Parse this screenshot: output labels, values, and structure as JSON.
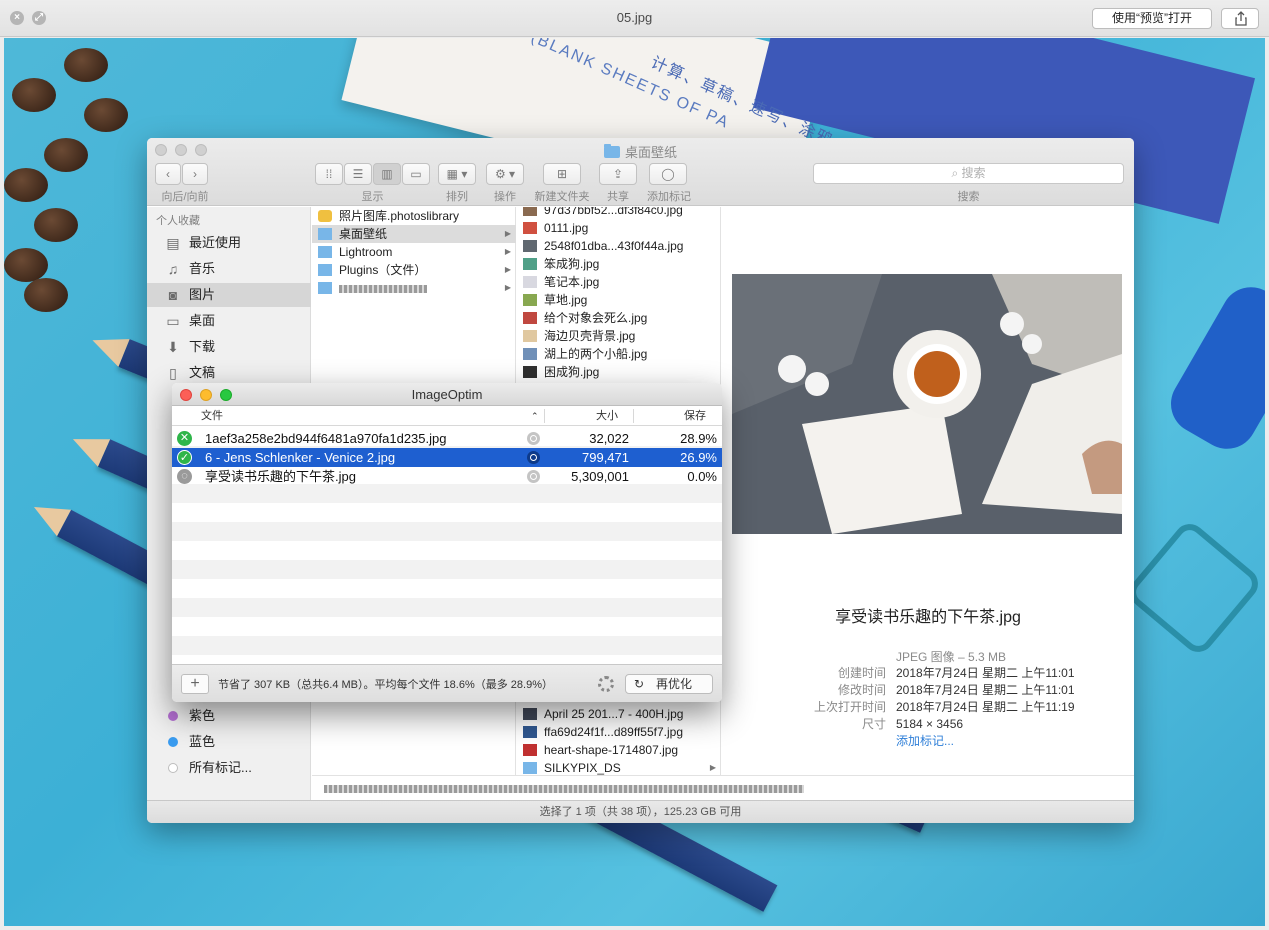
{
  "quicklook": {
    "title": "05.jpg",
    "open_with": "使用“预览”打开"
  },
  "backdrop": {
    "notebook_text": "S (BLANK SHEETS OF PA",
    "notebook_text2": "计算、草稿、速写、涂鸦"
  },
  "finder": {
    "title": "桌面壁纸",
    "toolbar": {
      "nav_label": "向后/向前",
      "view_label": "显示",
      "arrange_label": "排列",
      "action_label": "操作",
      "new_folder_label": "新建文件夹",
      "share_label": "共享",
      "tag_label": "添加标记",
      "search_placeholder": "搜索",
      "search_label": "搜索"
    },
    "sidebar": {
      "favorites_header": "个人收藏",
      "favorites": [
        "最近使用",
        "音乐",
        "图片",
        "桌面",
        "下载",
        "文稿"
      ],
      "tags": [
        {
          "label": "紫色",
          "color": "#b46fd2"
        },
        {
          "label": "蓝色",
          "color": "#3a9cf0"
        },
        {
          "label": "所有标记...",
          "color": "#d8d8d8"
        }
      ]
    },
    "column1": [
      "照片图库.photoslibrary",
      "桌面壁纸",
      "Lightroom",
      "Plugins（文件）"
    ],
    "column2_top": [
      "97d37bbf52...df3f84c0.jpg",
      "0111.jpg",
      "2548f01dba...43f0f44a.jpg",
      "笨成狗.jpg",
      "笔记本.jpg",
      "草地.jpg",
      "给个对象会死么.jpg",
      "海边贝壳背景.jpg",
      "湖上的两个小船.jpg",
      "困成狗.jpg"
    ],
    "column2_bottom": [
      "April 25 201...7 - 400H.jpg",
      "ffa69d24f1f...d89ff55f7.jpg",
      "heart-shape-1714807.jpg",
      "SILKYPIX_DS"
    ],
    "preview": {
      "name": "享受读书乐趣的下午茶.jpg",
      "kind": "JPEG 图像 – 5.3 MB",
      "created_k": "创建时间",
      "created_v": "2018年7月24日 星期二 上午11:01",
      "modified_k": "修改时间",
      "modified_v": "2018年7月24日 星期二 上午11:01",
      "opened_k": "上次打开时间",
      "opened_v": "2018年7月24日 星期二 上午11:19",
      "size_k": "尺寸",
      "size_v": "5184 × 3456",
      "add_tags": "添加标记..."
    },
    "status": "选择了 1 项（共 38 项），125.23 GB 可用"
  },
  "imageoptim": {
    "title": "ImageOptim",
    "col_file": "文件",
    "col_size": "大小",
    "col_saved": "保存",
    "rows": [
      {
        "name": "1aef3a258e2bd944f6481a970fa1d235.jpg",
        "size": "32,022",
        "saved": "28.9%"
      },
      {
        "name": "6 - Jens Schlenker - Venice 2.jpg",
        "size": "799,471",
        "saved": "26.9%"
      },
      {
        "name": "享受读书乐趣的下午茶.jpg",
        "size": "5,309,001",
        "saved": "0.0%"
      }
    ],
    "summary": "节省了 307 KB（总共6.4 MB）。平均每个文件 18.6%（最多 28.9%）",
    "reoptimize": "再优化",
    "add": "+"
  }
}
